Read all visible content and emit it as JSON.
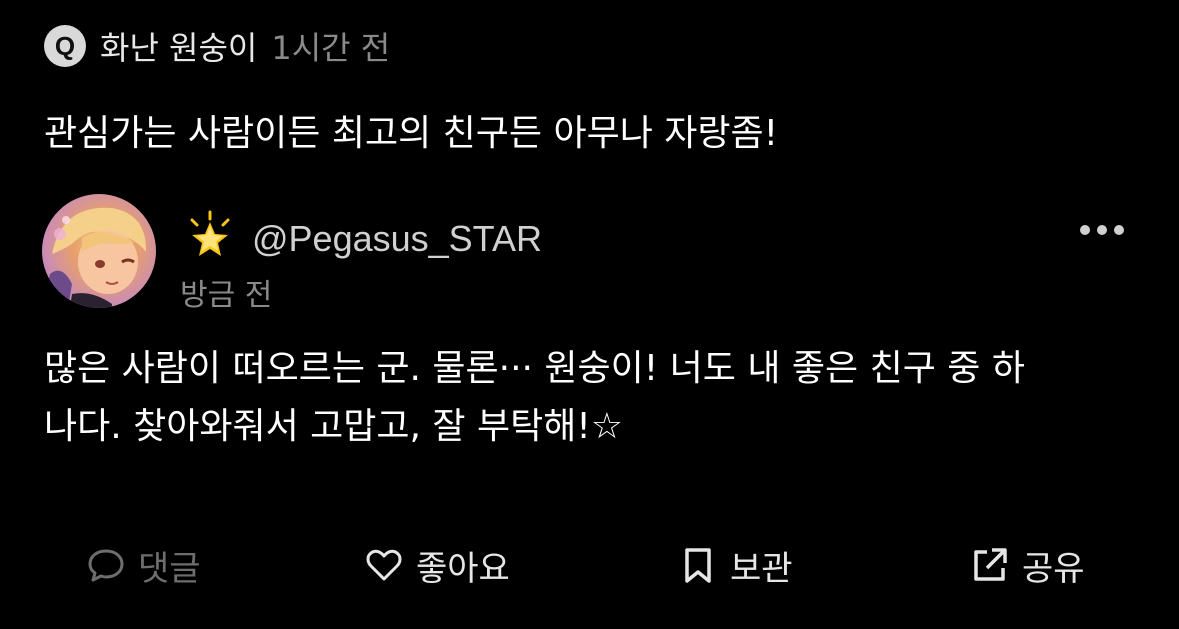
{
  "question": {
    "badge": "Q",
    "asker": "화난 원숭이",
    "time": "1시간 전",
    "text": "관심가는 사람이든 최고의 친구든 아무나 자랑좀!"
  },
  "answer": {
    "badge_icon": "star-icon",
    "handle": "@Pegasus_STAR",
    "time": "방금 전",
    "text_line1": "많은 사람이 떠오르는 군. 물론··· 원숭이! 너도 내 좋은 친구 중 하",
    "text_line2": "나다. 찾아와줘서 고맙고, 잘 부탁해!☆"
  },
  "actions": {
    "comment": "댓글",
    "like": "좋아요",
    "save": "보관",
    "share": "공유"
  },
  "colors": {
    "background": "#000000",
    "muted": "#8a8a8a",
    "disabled": "#6e6e6e",
    "star": "#f5c518"
  }
}
